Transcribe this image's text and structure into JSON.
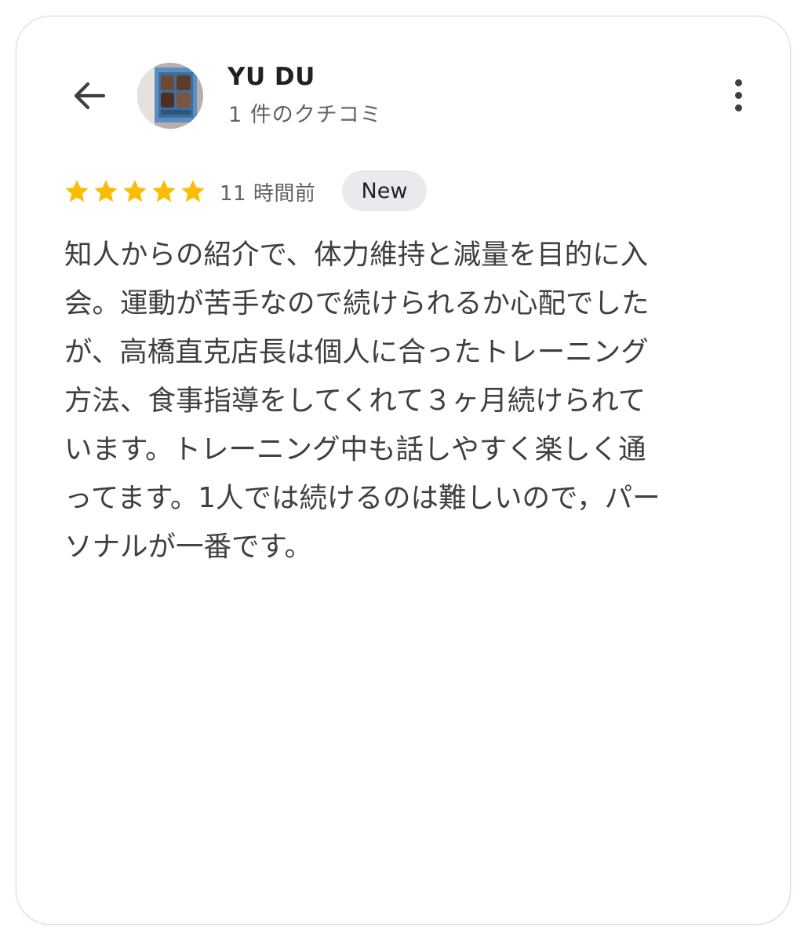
{
  "header": {
    "back_icon": "arrow-left-icon",
    "user_name": "YU DU",
    "review_count": "1 件のクチコミ",
    "more_icon": "more-vert-icon"
  },
  "review": {
    "rating": 5,
    "rating_max": 5,
    "star_color": "#fbbc04",
    "time_ago": "11 時間前",
    "badge": "New",
    "text": "知人からの紹介で、体力維持と減量を目的に入\n会。運動が苦手なので続けられるか心配でした\nが、高橋直克店長は個人に合ったトレーニング\n方法、食事指導をしてくれて３ヶ月続けられて\nいます。トレーニング中も話しやすく楽しく通\nってます。1人では続けるのは難しいので，パー\nソナルが一番です。"
  }
}
